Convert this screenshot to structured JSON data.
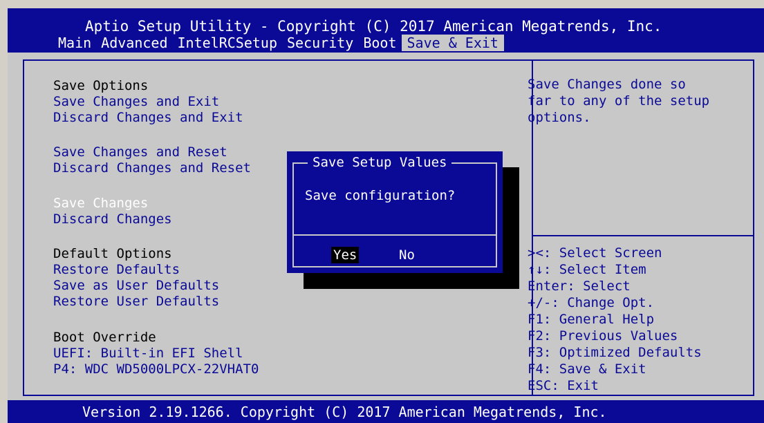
{
  "header": {
    "title": "Aptio Setup Utility - Copyright (C) 2017 American Megatrends, Inc.",
    "tabs": [
      "Main",
      "Advanced",
      "IntelRCSetup",
      "Security",
      "Boot",
      "Save & Exit"
    ],
    "active_tab": "Save & Exit"
  },
  "menu": {
    "save_options_heading": "Save Options",
    "save_changes_and_exit": "Save Changes and Exit",
    "discard_changes_and_exit": "Discard Changes and Exit",
    "save_changes_and_reset": "Save Changes and Reset",
    "discard_changes_and_reset": "Discard Changes and Reset",
    "save_changes": "Save Changes",
    "discard_changes": "Discard Changes",
    "default_options_heading": "Default Options",
    "restore_defaults": "Restore Defaults",
    "save_as_user_defaults": "Save as User Defaults",
    "restore_user_defaults": "Restore User Defaults",
    "boot_override_heading": "Boot Override",
    "boot_uefi_shell": "UEFI: Built-in EFI Shell",
    "boot_p4": "P4: WDC WD5000LPCX-22VHAT0"
  },
  "help": {
    "lines": [
      "Save Changes done so",
      "far to any of the setup",
      "options."
    ]
  },
  "keys": {
    "lines": [
      "><: Select Screen",
      "↑↓: Select Item",
      "Enter: Select",
      "+/-: Change Opt.",
      "F1: General Help",
      "F2: Previous Values",
      "F3: Optimized Defaults",
      "F4: Save & Exit",
      "ESC: Exit"
    ]
  },
  "dialog": {
    "title": "Save Setup Values",
    "message": "Save configuration?",
    "yes_label": "Yes",
    "no_label": "No"
  },
  "footer": {
    "text": "Version 2.19.1266. Copyright (C) 2017 American Megatrends, Inc."
  },
  "colors": {
    "bios_blue": "#0a0a96",
    "panel_gray": "#c8c8c8",
    "text_white": "#ffffff",
    "text_black": "#000000"
  }
}
